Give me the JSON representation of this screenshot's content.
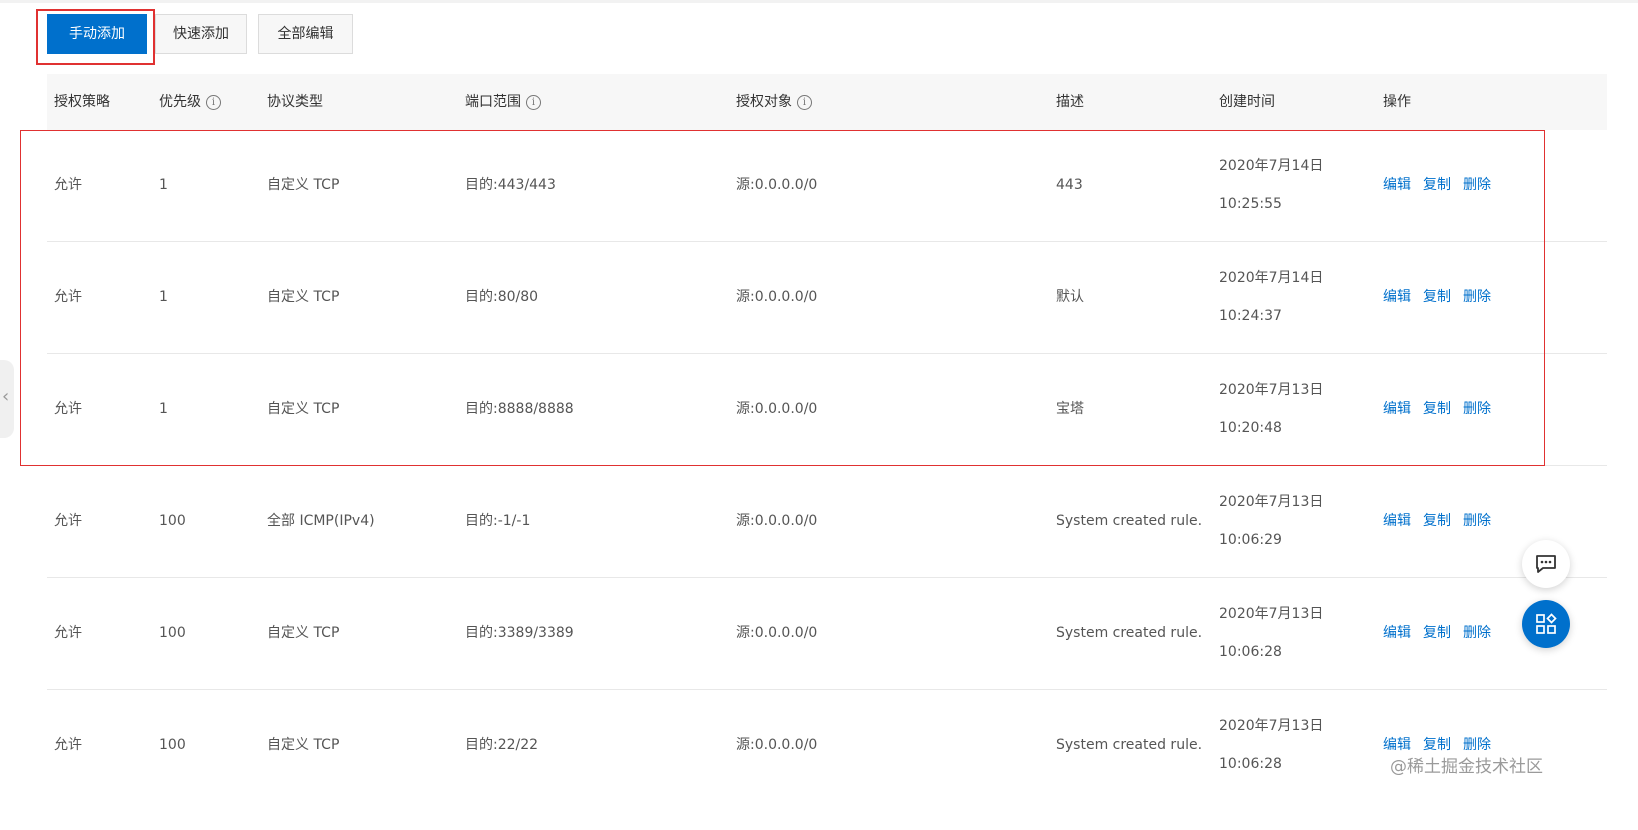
{
  "toolbar": {
    "manual_add": "手动添加",
    "quick_add": "快速添加",
    "edit_all": "全部编辑"
  },
  "table": {
    "headers": {
      "policy": "授权策略",
      "priority": "优先级",
      "protocol": "协议类型",
      "port_range": "端口范围",
      "auth_object": "授权对象",
      "description": "描述",
      "created_time": "创建时间",
      "actions": "操作"
    },
    "info_glyph": "i",
    "rows": [
      {
        "policy": "允许",
        "priority": "1",
        "protocol": "自定义 TCP",
        "port": "目的:443/443",
        "object": "源:0.0.0.0/0",
        "desc": "443",
        "date": "2020年7月14日",
        "time": "10:25:55"
      },
      {
        "policy": "允许",
        "priority": "1",
        "protocol": "自定义 TCP",
        "port": "目的:80/80",
        "object": "源:0.0.0.0/0",
        "desc": "默认",
        "date": "2020年7月14日",
        "time": "10:24:37"
      },
      {
        "policy": "允许",
        "priority": "1",
        "protocol": "自定义 TCP",
        "port": "目的:8888/8888",
        "object": "源:0.0.0.0/0",
        "desc": "宝塔",
        "date": "2020年7月13日",
        "time": "10:20:48"
      },
      {
        "policy": "允许",
        "priority": "100",
        "protocol": "全部 ICMP(IPv4)",
        "port": "目的:-1/-1",
        "object": "源:0.0.0.0/0",
        "desc": "System created rule.",
        "date": "2020年7月13日",
        "time": "10:06:29"
      },
      {
        "policy": "允许",
        "priority": "100",
        "protocol": "自定义 TCP",
        "port": "目的:3389/3389",
        "object": "源:0.0.0.0/0",
        "desc": "System created rule.",
        "date": "2020年7月13日",
        "time": "10:06:28"
      },
      {
        "policy": "允许",
        "priority": "100",
        "protocol": "自定义 TCP",
        "port": "目的:22/22",
        "object": "源:0.0.0.0/0",
        "desc": "System created rule.",
        "date": "2020年7月13日",
        "time": "10:06:28"
      }
    ],
    "actions": {
      "edit": "编辑",
      "copy": "复制",
      "delete": "删除"
    }
  },
  "watermark": "@稀土掘金技术社区",
  "colors": {
    "primary": "#0070cc",
    "highlight": "#e03131"
  },
  "icons": {
    "collapse": "chevron-left-icon",
    "chat": "chat-icon",
    "apps": "apps-icon"
  }
}
